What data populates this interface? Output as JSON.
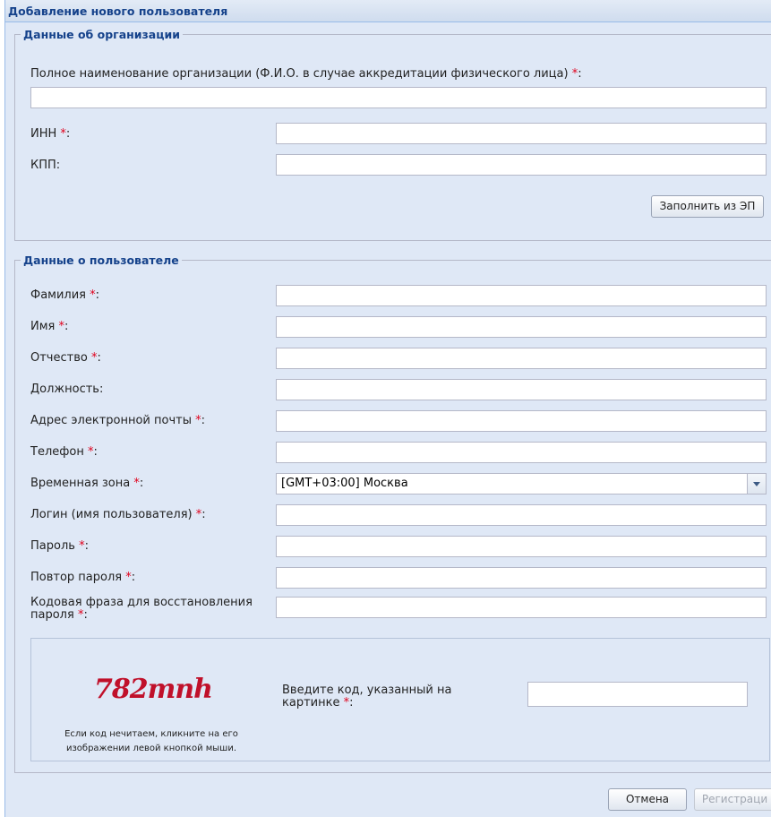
{
  "window": {
    "title": "Добавление нового пользователя"
  },
  "org": {
    "legend": "Данные об организации",
    "full_name_label": "Полное наименование организации (Ф.И.О. в случае аккредитации физического лица)",
    "inn_label": "ИНН",
    "kpp_label": "КПП:",
    "fill_button": "Заполнить из ЭП"
  },
  "user": {
    "legend": "Данные о пользователе",
    "fields": {
      "last_name": "Фамилия",
      "first_name": "Имя",
      "patronymic": "Отчество",
      "position": "Должность:",
      "email": "Адрес электронной почты",
      "phone": "Телефон",
      "timezone": "Временная зона",
      "login": "Логин (имя пользователя)",
      "password": "Пароль",
      "password_repeat": "Повтор пароля",
      "codephrase_line1": "Кодовая фраза для восстановления",
      "codephrase_line2": "пароля"
    },
    "timezone_value": "[GMT+03:00] Москва"
  },
  "captcha": {
    "image_text": "782mnh",
    "note_line1": "Если код нечитаем, кликните на его",
    "note_line2": "изображении левой кнопкой мыши.",
    "prompt_line1": "Введите код, указанный на",
    "prompt_line2": "картинке"
  },
  "buttons": {
    "cancel": "Отмена",
    "register": "Регистраци"
  },
  "markers": {
    "required": "*",
    "colon": ":"
  },
  "colors": {
    "title": "#15428b",
    "background": "#dfe8f6",
    "required": "#e0001b"
  }
}
